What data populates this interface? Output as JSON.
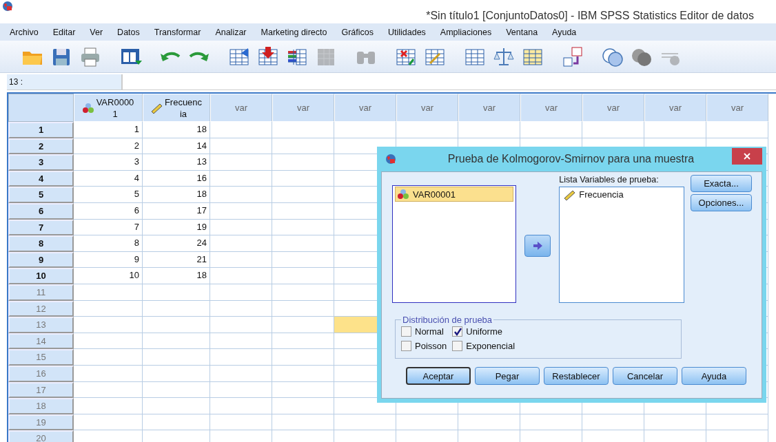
{
  "window": {
    "title": "*Sin título1 [ConjuntoDatos0] - IBM SPSS Statistics Editor de datos"
  },
  "menu": [
    "Archivo",
    "Editar",
    "Ver",
    "Datos",
    "Transformar",
    "Analizar",
    "Marketing directo",
    "Gráficos",
    "Utilidades",
    "Ampliaciones",
    "Ventana",
    "Ayuda"
  ],
  "toolbar": [
    {
      "disabled": false
    },
    {
      "disabled": false
    },
    {
      "disabled": false
    },
    {
      "disabled": false
    },
    {
      "disabled": false
    },
    {
      "disabled": false
    },
    {
      "disabled": false
    },
    {
      "disabled": false
    },
    {
      "disabled": false
    },
    {
      "disabled": true
    },
    {
      "disabled": true
    },
    {
      "disabled": false
    },
    {
      "disabled": false
    },
    {
      "disabled": false
    },
    {
      "disabled": false
    },
    {
      "disabled": false
    },
    {
      "disabled": false
    },
    {
      "disabled": false
    },
    {
      "disabled": false
    },
    {
      "disabled": true
    }
  ],
  "cell_reference": "13 :",
  "grid": {
    "columns": [
      {
        "name": "VAR00001",
        "kind": "nominal"
      },
      {
        "name": "Frecuencia",
        "kind": "scale"
      },
      {
        "name": "var",
        "kind": "empty"
      },
      {
        "name": "var",
        "kind": "empty"
      },
      {
        "name": "var",
        "kind": "empty"
      },
      {
        "name": "var",
        "kind": "empty"
      },
      {
        "name": "var",
        "kind": "empty"
      },
      {
        "name": "var",
        "kind": "empty"
      },
      {
        "name": "var",
        "kind": "empty"
      },
      {
        "name": "var",
        "kind": "empty"
      },
      {
        "name": "var",
        "kind": "empty"
      }
    ],
    "rows": [
      {
        "label": "1",
        "cells": [
          {
            "value": "1",
            "selected": false
          },
          {
            "value": "18",
            "selected": false
          },
          {
            "selected": false
          },
          {
            "selected": false
          },
          {
            "selected": false
          },
          {
            "selected": false
          },
          {
            "selected": false
          },
          {
            "selected": false
          },
          {
            "selected": false
          },
          {
            "selected": false
          },
          {
            "selected": false
          }
        ]
      },
      {
        "label": "2",
        "cells": [
          {
            "value": "2",
            "selected": false
          },
          {
            "value": "14",
            "selected": false
          },
          {
            "selected": false
          },
          {
            "selected": false
          },
          {
            "selected": false
          },
          {
            "selected": false
          },
          {
            "selected": false
          },
          {
            "selected": false
          },
          {
            "selected": false
          },
          {
            "selected": false
          },
          {
            "selected": false
          }
        ]
      },
      {
        "label": "3",
        "cells": [
          {
            "value": "3",
            "selected": false
          },
          {
            "value": "13",
            "selected": false
          },
          {
            "selected": false
          },
          {
            "selected": false
          },
          {
            "selected": false
          }
        ]
      },
      {
        "label": "4",
        "cells": [
          {
            "value": "4",
            "selected": false
          },
          {
            "value": "16",
            "selected": false
          },
          {
            "selected": false
          },
          {
            "selected": false
          },
          {
            "selected": false
          }
        ]
      },
      {
        "label": "5",
        "cells": [
          {
            "value": "5",
            "selected": false
          },
          {
            "value": "18",
            "selected": false
          },
          {
            "selected": false
          },
          {
            "selected": false
          },
          {
            "selected": false
          }
        ]
      },
      {
        "label": "6",
        "cells": [
          {
            "value": "6",
            "selected": false
          },
          {
            "value": "17",
            "selected": false
          },
          {
            "selected": false
          },
          {
            "selected": false
          },
          {
            "selected": false
          }
        ]
      },
      {
        "label": "7",
        "cells": [
          {
            "value": "7",
            "selected": false
          },
          {
            "value": "19",
            "selected": false
          },
          {
            "selected": false
          },
          {
            "selected": false
          },
          {
            "selected": false
          }
        ]
      },
      {
        "label": "8",
        "cells": [
          {
            "value": "8",
            "selected": false
          },
          {
            "value": "24",
            "selected": false
          },
          {
            "selected": false
          },
          {
            "selected": false
          },
          {
            "selected": false
          }
        ]
      },
      {
        "label": "9",
        "cells": [
          {
            "value": "9",
            "selected": false
          },
          {
            "value": "21",
            "selected": false
          },
          {
            "selected": false
          },
          {
            "selected": false
          },
          {
            "selected": false
          }
        ]
      },
      {
        "label": "10",
        "cells": [
          {
            "value": "10",
            "selected": false
          },
          {
            "value": "18",
            "selected": false
          },
          {
            "selected": false
          },
          {
            "selected": false
          },
          {
            "selected": false
          }
        ]
      },
      {
        "label": "11",
        "cells": [
          {
            "selected": false
          },
          {
            "selected": false
          },
          {
            "selected": false
          },
          {
            "selected": false
          },
          {
            "selected": false
          }
        ]
      },
      {
        "label": "12",
        "cells": [
          {
            "selected": false
          },
          {
            "selected": false
          },
          {
            "selected": false
          },
          {
            "selected": false
          },
          {
            "selected": false
          }
        ]
      },
      {
        "label": "13",
        "cells": [
          {
            "selected": false
          },
          {
            "selected": false
          },
          {
            "selected": false
          },
          {
            "selected": false
          },
          {
            "selected": true
          }
        ]
      },
      {
        "label": "14",
        "cells": [
          {
            "selected": false
          },
          {
            "selected": false
          },
          {
            "selected": false
          },
          {
            "selected": false
          },
          {
            "selected": false
          }
        ]
      },
      {
        "label": "15",
        "cells": [
          {
            "selected": false
          },
          {
            "selected": false
          },
          {
            "selected": false
          },
          {
            "selected": false
          },
          {
            "selected": false
          }
        ]
      },
      {
        "label": "16",
        "cells": [
          {
            "selected": false
          },
          {
            "selected": false
          },
          {
            "selected": false
          },
          {
            "selected": false
          },
          {
            "selected": false
          }
        ]
      },
      {
        "label": "17",
        "cells": [
          {
            "selected": false
          },
          {
            "selected": false
          },
          {
            "selected": false
          },
          {
            "selected": false
          },
          {
            "selected": false
          }
        ]
      },
      {
        "label": "18",
        "cells": [
          {
            "selected": false
          },
          {
            "selected": false
          },
          {
            "selected": false
          },
          {
            "selected": false
          },
          {
            "selected": false
          },
          {
            "selected": false
          },
          {
            "selected": false
          },
          {
            "selected": false
          },
          {
            "selected": false
          },
          {
            "selected": false
          },
          {
            "selected": false
          }
        ]
      },
      {
        "label": "19",
        "cells": [
          {
            "selected": false
          },
          {
            "selected": false
          },
          {
            "selected": false
          },
          {
            "selected": false
          },
          {
            "selected": false
          },
          {
            "selected": false
          },
          {
            "selected": false
          },
          {
            "selected": false
          },
          {
            "selected": false
          },
          {
            "selected": false
          },
          {
            "selected": false
          }
        ]
      },
      {
        "label": "20",
        "cells": [
          {
            "selected": false
          },
          {
            "selected": false
          },
          {
            "selected": false
          },
          {
            "selected": false
          },
          {
            "selected": false
          },
          {
            "selected": false
          },
          {
            "selected": false
          },
          {
            "selected": false
          },
          {
            "selected": false
          },
          {
            "selected": false
          },
          {
            "selected": false
          }
        ]
      }
    ]
  },
  "dialog": {
    "title": "Prueba de Kolmogorov-Smirnov para una muestra",
    "source_list": [
      {
        "label": "VAR00001",
        "kind": "nominal",
        "selected": true
      }
    ],
    "target_label": "Lista Variables de prueba:",
    "target_list": [
      {
        "label": "Frecuencia",
        "kind": "scale",
        "selected": false
      }
    ],
    "side_buttons": [
      "Exacta...",
      "Opciones..."
    ],
    "distribution": {
      "title": "Distribución de prueba",
      "options": [
        {
          "label": "Normal",
          "checked": false
        },
        {
          "label": "Uniforme",
          "checked": true
        },
        {
          "label": "Poisson",
          "checked": false
        },
        {
          "label": "Exponencial",
          "checked": false
        }
      ]
    },
    "buttons": [
      {
        "label": "Aceptar",
        "default": true
      },
      {
        "label": "Pegar",
        "default": false
      },
      {
        "label": "Restablecer",
        "default": false
      },
      {
        "label": "Cancelar",
        "default": false
      },
      {
        "label": "Ayuda",
        "default": false
      }
    ]
  }
}
